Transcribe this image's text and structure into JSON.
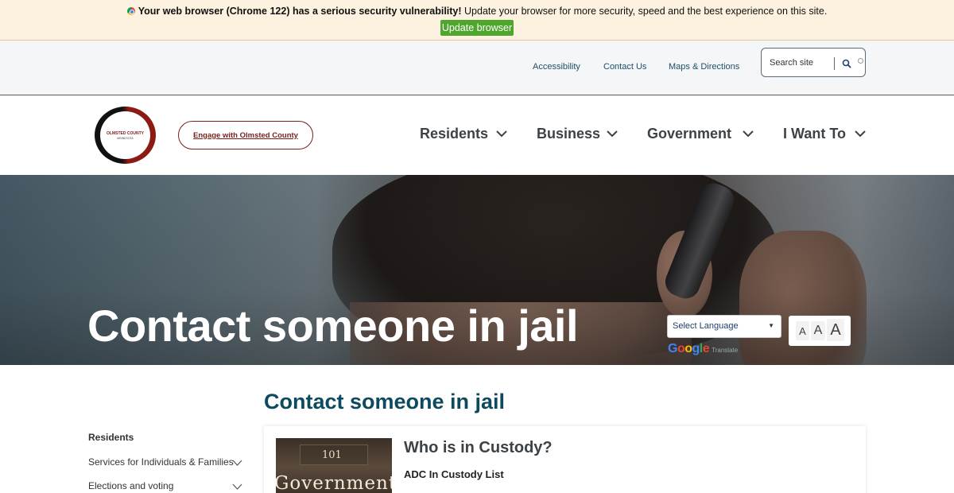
{
  "banner": {
    "warning_bold": "Your web browser (Chrome 122) has a serious security vulnerability!",
    "warning_text": "Update your browser for more security, speed and the best experience on this site.",
    "update_label": "Update browser",
    "icon": "chrome-icon"
  },
  "utility_nav": {
    "links": [
      "Accessibility",
      "Contact Us",
      "Maps & Directions"
    ],
    "search_placeholder": "Search site"
  },
  "header": {
    "logo_text": "OLMSTED COUNTY",
    "logo_subtext": "MINNESOTA",
    "engage_label": "Engage with Olmsted County",
    "nav": [
      "Residents",
      "Business",
      "Government",
      "I Want To"
    ]
  },
  "hero": {
    "title": "Contact someone in jail",
    "language_select": "Select Language",
    "translate_label": "Translate",
    "google_brand": "Google",
    "font_sizes": [
      "A",
      "A",
      "A"
    ]
  },
  "content": {
    "heading": "Contact someone in jail",
    "sidenav": {
      "title": "Residents",
      "items": [
        "Services for Individuals & Families",
        "Elections and voting"
      ]
    },
    "card": {
      "title": "Who is in Custody?",
      "link": "ADC In Custody List",
      "image_number": "101",
      "image_word": "Government"
    }
  },
  "colors": {
    "accent_teal": "#0e4a5e",
    "brand_red": "#7a1f1a",
    "update_green": "#4ea72c",
    "banner_bg": "#fdf2e0"
  }
}
